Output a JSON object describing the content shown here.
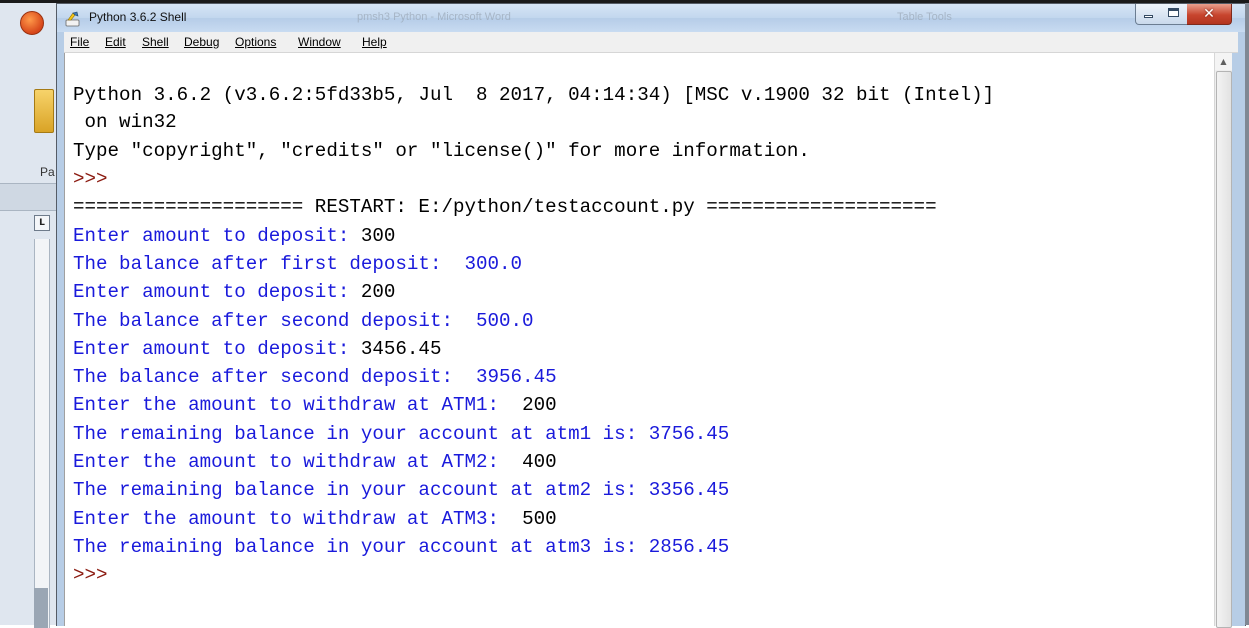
{
  "window": {
    "title": "Python 3.6.2 Shell",
    "ghost_title_1": "pmsh3 Python - Microsoft Word",
    "ghost_title_2": "Table Tools",
    "close_glyph": "✕"
  },
  "background_app": {
    "paste_label": "Pa",
    "tab_selector": "L"
  },
  "menu": {
    "file": "File",
    "edit": "Edit",
    "shell": "Shell",
    "debug": "Debug",
    "options": "Options",
    "window": "Window",
    "help": "Help"
  },
  "shell": {
    "banner_1": "Python 3.6.2 (v3.6.2:5fd33b5, Jul  8 2017, 04:14:34) [MSC v.1900 32 bit (Intel)]",
    "banner_2": " on win32",
    "banner_3": "Type \"copyright\", \"credits\" or \"license()\" for more information.",
    "prompt": ">>>",
    "restart": "==================== RESTART: E:/python/testaccount.py ====================",
    "l1_text": "Enter amount to deposit: ",
    "l1_val": "300",
    "l2": "The balance after first deposit:  300.0",
    "l3_text": "Enter amount to deposit: ",
    "l3_val": "200",
    "l4": "The balance after second deposit:  500.0",
    "l5_text": "Enter amount to deposit: ",
    "l5_val": "3456.45",
    "l6": "The balance after second deposit:  3956.45",
    "l7_text": "Enter the amount to withdraw at ATM1:  ",
    "l7_val": "200",
    "l8": "The remaining balance in your account at atm1 is: 3756.45",
    "l9_text": "Enter the amount to withdraw at ATM2:  ",
    "l9_val": "400",
    "l10": "The remaining balance in your account at atm2 is: 3356.45",
    "l11_text": "Enter the amount to withdraw at ATM3:  ",
    "l11_val": "500",
    "l12": "The remaining balance in your account at atm3 is: 2856.45",
    "final_prompt": ">>>"
  },
  "colors": {
    "stdout": "#1a1adb",
    "prompt": "#8b1a10",
    "text": "#000000"
  },
  "icons": {
    "app": "python-idle-icon",
    "minimize": "minimize-icon",
    "maximize": "maximize-icon",
    "close": "close-icon",
    "scroll_up": "scroll-up-arrow-icon"
  }
}
